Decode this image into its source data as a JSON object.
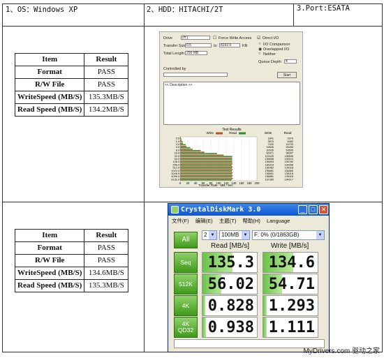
{
  "header": {
    "os": "1、OS：Windows XP",
    "hdd": "2、HDD：HITACHI/2T",
    "port": "3.Port:ESATA"
  },
  "table1": {
    "head": [
      "Item",
      "Result"
    ],
    "rows": [
      [
        "Format",
        "PASS"
      ],
      [
        "R/W File",
        "PASS"
      ],
      [
        "WriteSpeed (MB/S)",
        "135.3MB/S"
      ],
      [
        "Read  Speed (MB/S)",
        "134.2MB/S"
      ]
    ]
  },
  "table2": {
    "head": [
      "Item",
      "Result"
    ],
    "rows": [
      [
        "Format",
        "PASS"
      ],
      [
        "R/W File",
        "PASS"
      ],
      [
        "WriteSpeed (MB/S)",
        "134.6MB/S"
      ],
      [
        "Read  Speed (MB/S)",
        "135.3MB/S"
      ]
    ]
  },
  "hdtune": {
    "drive_label": "Drive",
    "drive_value": "(H:)",
    "force_write_access": "Force Write Access",
    "transfer_size_label": "Transfer Size",
    "transfer_from": "0.5",
    "transfer_to_label": "to",
    "transfer_to": "8192.0",
    "kb_label": "KB",
    "total_length_label": "Total Length",
    "total_length": "256 MB",
    "direct_io": "Direct I/O",
    "io_comparison": "I/O Comparison",
    "overlapped_io": "Overlapped I/O",
    "neither": "Neither",
    "queue_depth_label": "Queue Depth",
    "queue_depth": "4",
    "controlled_by": "Controlled by",
    "start_button": "Start",
    "description": "<< Description >>",
    "results_title": "Test Results",
    "legend_write": "Write",
    "legend_read": "Read",
    "col_write": "Write",
    "col_read": "Read",
    "x_axis_label": "Transfer Rate - MB / Sec",
    "colors": {
      "write": "#b5532d",
      "read": "#2f8f2f"
    }
  },
  "chart_data": {
    "type": "bar",
    "title": "Test Results",
    "xlabel": "Transfer Rate - MB / Sec",
    "ylabel": "",
    "xlim": [
      0,
      200
    ],
    "x_ticks": [
      "0",
      "20",
      "40",
      "60",
      "80",
      "100",
      "120",
      "140",
      "160",
      "180",
      "200"
    ],
    "categories": [
      "0.5",
      "1.0",
      "2.0",
      "4.0",
      "8.0",
      "16.0",
      "32.0",
      "64.0",
      "128.0",
      "256.0",
      "512.0",
      "1024.0",
      "2048.0",
      "4096.0",
      "8192.0"
    ],
    "series": [
      {
        "name": "Write",
        "values": [
          1841,
          3579,
          7432,
          16606,
          32635,
          62971,
          113425,
          135658,
          135593,
          136318,
          136482,
          136881,
          136801,
          136881,
          137385
        ]
      },
      {
        "name": "Read",
        "values": [
          3379,
          6482,
          14700,
          26458,
          53695,
          96067,
          135696,
          135372,
          135780,
          134358,
          135118,
          134666,
          135118,
          135118,
          134217
        ]
      }
    ],
    "grid": true,
    "legend": "top-center"
  },
  "crystaldiskmark": {
    "title": "CrystalDiskMark 3.0",
    "menu": [
      "文件(F)",
      "编辑(E)",
      "主题(T)",
      "帮助(H)",
      "Language"
    ],
    "all_button": "All",
    "runs": "2",
    "size": "100MB",
    "drive": "F: 0% (0/1863GB)",
    "read_header": "Read [MB/s]",
    "write_header": "Write [MB/s]",
    "rows": [
      {
        "label": "Seq",
        "read": "135.3",
        "write": "134.6",
        "read_fill": 0.55,
        "write_fill": 0.55
      },
      {
        "label": "512K",
        "read": "56.02",
        "write": "54.71",
        "read_fill": 0.35,
        "write_fill": 0.34
      },
      {
        "label": "4K",
        "read": "0.828",
        "write": "1.293",
        "read_fill": 0.05,
        "write_fill": 0.07
      },
      {
        "label": "4K\nQD32",
        "read": "0.938",
        "write": "1.111",
        "read_fill": 0.06,
        "write_fill": 0.07
      }
    ]
  },
  "watermark": "MyDrivers.com 驱动之家"
}
